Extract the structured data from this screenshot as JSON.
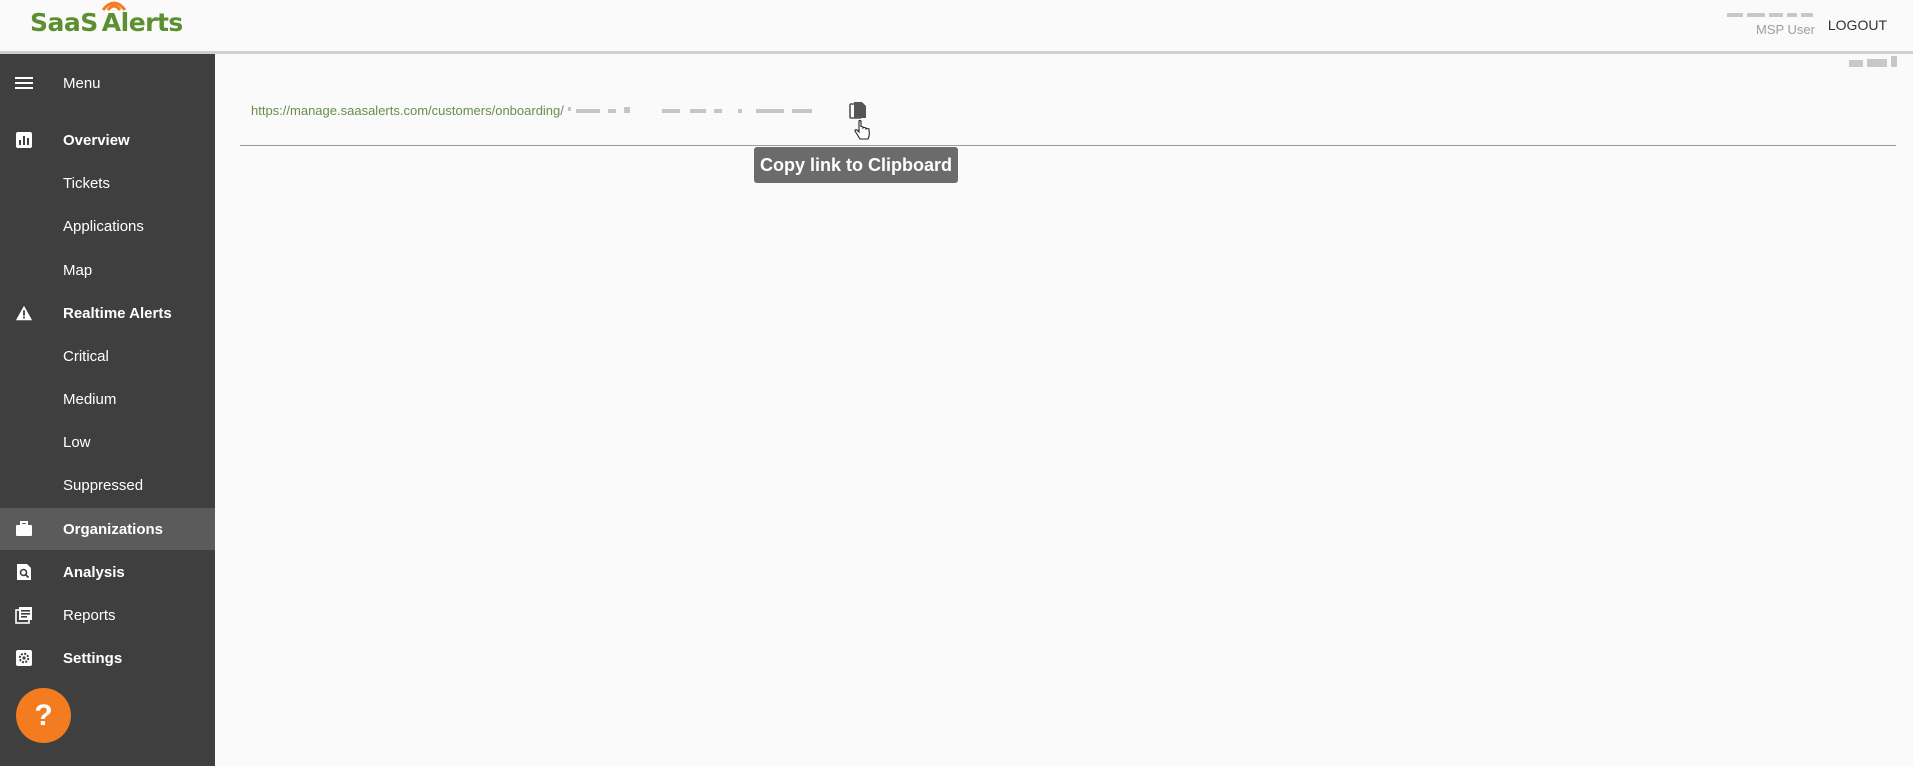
{
  "header": {
    "logo_text_1": "SaaS",
    "logo_text_2": "lerts",
    "user_role": "MSP User",
    "logout_label": "LOGOUT"
  },
  "sidebar": {
    "items": [
      {
        "label": "Menu",
        "icon": "hamburger-menu-icon"
      },
      {
        "label": "Overview",
        "icon": "bar-chart-icon"
      },
      {
        "label": "Tickets"
      },
      {
        "label": "Applications"
      },
      {
        "label": "Map"
      },
      {
        "label": "Realtime Alerts",
        "icon": "warning-icon"
      },
      {
        "label": "Critical"
      },
      {
        "label": "Medium"
      },
      {
        "label": "Low"
      },
      {
        "label": "Suppressed"
      },
      {
        "label": "Organizations",
        "icon": "briefcase-icon"
      },
      {
        "label": "Analysis",
        "icon": "document-search-icon"
      },
      {
        "label": "Reports",
        "icon": "reports-icon"
      },
      {
        "label": "Settings",
        "icon": "gear-icon"
      }
    ],
    "active_item": "Organizations",
    "help_label": "?"
  },
  "main": {
    "onboarding_link": "https://manage.saasalerts.com/customers/onboarding/",
    "copy_icon": "copy-icon",
    "tooltip": "Copy link to Clipboard"
  },
  "colors": {
    "sidebar_bg": "#3f3f3f",
    "active_bg": "#5b5b5b",
    "brand_green": "#5b8f2f",
    "help_orange": "#f47c20",
    "link_green": "#6a8d4d"
  }
}
